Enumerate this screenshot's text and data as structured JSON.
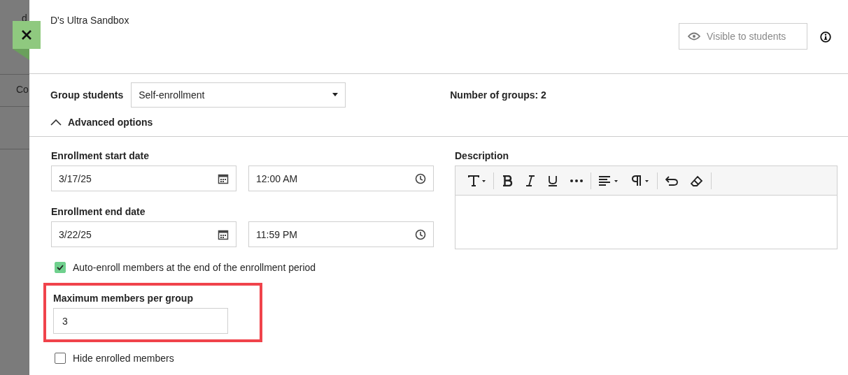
{
  "background": {
    "texts": [
      "d",
      "Co"
    ]
  },
  "header": {
    "title": "D's Ultra Sandbox",
    "visibility_button": "Visible to students"
  },
  "group_students": {
    "label": "Group students",
    "value": "Self-enrollment"
  },
  "group_count": "Number of groups: 2",
  "advanced_options": {
    "label": "Advanced options",
    "expanded": true
  },
  "enrollment_start": {
    "label": "Enrollment start date",
    "date": "3/17/25",
    "time": "12:00 AM"
  },
  "enrollment_end": {
    "label": "Enrollment end date",
    "date": "3/22/25",
    "time": "11:59 PM"
  },
  "auto_enroll": {
    "label": "Auto-enroll members at the end of the enrollment period",
    "checked": true
  },
  "max_members": {
    "label": "Maximum members per group",
    "value": "3",
    "highlighted": true
  },
  "hide_enrolled": {
    "label": "Hide enrolled members",
    "checked": false
  },
  "description": {
    "label": "Description"
  }
}
